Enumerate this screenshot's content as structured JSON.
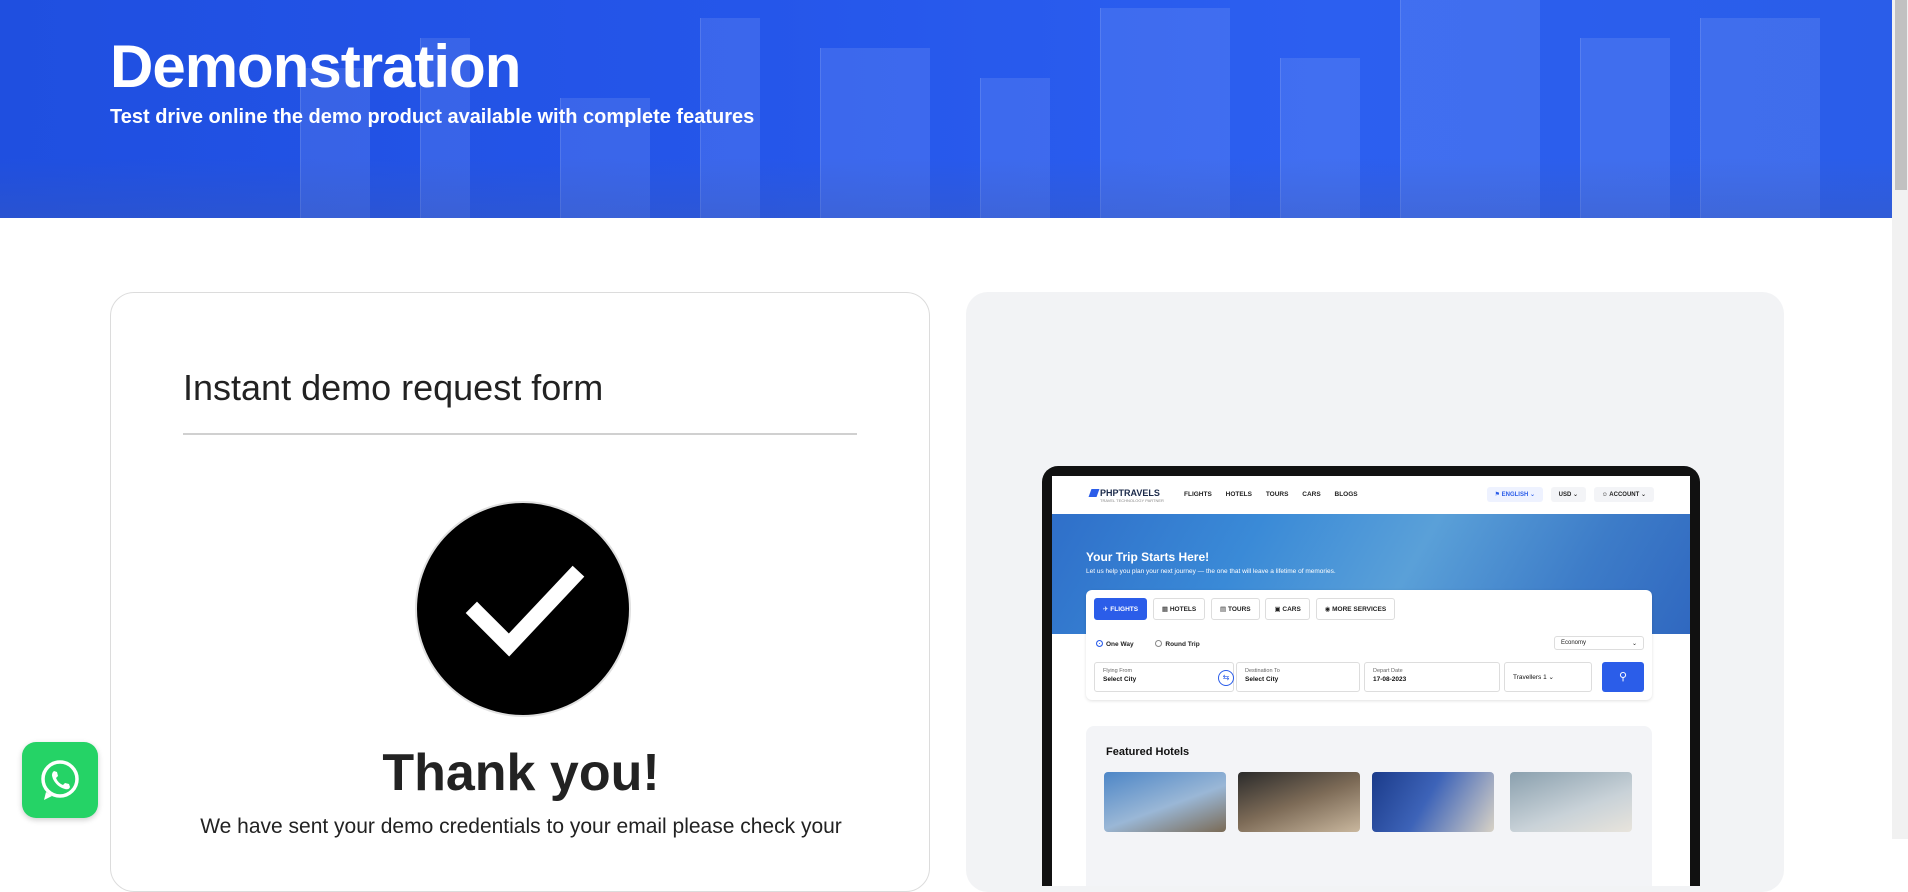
{
  "hero": {
    "title": "Demonstration",
    "subtitle": "Test drive online the demo product available with complete features"
  },
  "form": {
    "heading": "Instant demo request form",
    "success_icon": "checkmark-icon",
    "thank_you": "Thank you!",
    "message": "We have sent your demo credentials to your email please check your"
  },
  "preview": {
    "nav": {
      "logo": "PHPTRAVELS",
      "logo_tagline": "TRAVEL TECHNOLOGY PARTNER",
      "menu": [
        "FLIGHTS",
        "HOTELS",
        "TOURS",
        "CARS",
        "BLOGS"
      ],
      "language": "ENGLISH",
      "currency": "USD",
      "account": "ACCOUNT"
    },
    "hero": {
      "title": "Your Trip Starts Here!",
      "subtitle": "Let us help you plan your next journey — the one that will leave a lifetime of memories."
    },
    "tabs": [
      "FLIGHTS",
      "HOTELS",
      "TOURS",
      "CARS",
      "MORE SERVICES"
    ],
    "trip_types": [
      "One Way",
      "Round Trip"
    ],
    "cabin_class": "Economy",
    "fields": {
      "from_label": "Flying From",
      "from_value": "Select City",
      "to_label": "Destination To",
      "to_value": "Select City",
      "date_label": "Depart Date",
      "date_value": "17-08-2023",
      "travellers": "Travellers 1"
    },
    "featured_title": "Featured Hotels"
  },
  "colors": {
    "brand_blue": "#2b5de9",
    "whatsapp_green": "#25d366"
  },
  "whatsapp_icon": "whatsapp-icon"
}
